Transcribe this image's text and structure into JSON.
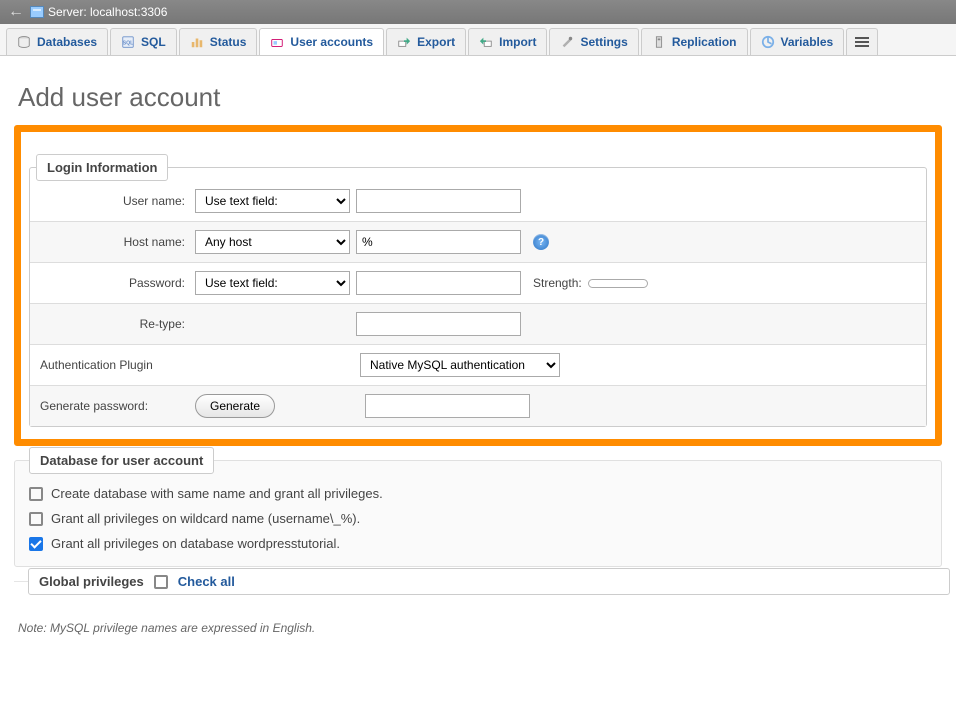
{
  "server_bar": {
    "back_arrow": "←",
    "label": "Server: localhost:3306"
  },
  "tabs": {
    "databases": "Databases",
    "sql": "SQL",
    "status": "Status",
    "user_accounts": "User accounts",
    "export": "Export",
    "import": "Import",
    "settings": "Settings",
    "replication": "Replication",
    "variables": "Variables"
  },
  "page_title": "Add user account",
  "login_info": {
    "legend": "Login Information",
    "rows": {
      "user_name": {
        "label": "User name:",
        "select": "Use text field:",
        "value": ""
      },
      "host_name": {
        "label": "Host name:",
        "select": "Any host",
        "value": "%"
      },
      "password": {
        "label": "Password:",
        "select": "Use text field:",
        "value": "",
        "strength_label": "Strength:"
      },
      "retype": {
        "label": "Re-type:",
        "value": ""
      },
      "auth": {
        "label": "Authentication Plugin",
        "select": "Native MySQL authentication"
      },
      "generate": {
        "label": "Generate password:",
        "button": "Generate",
        "value": ""
      }
    }
  },
  "db_section": {
    "legend": "Database for user account",
    "options": [
      {
        "label": "Create database with same name and grant all privileges.",
        "checked": false
      },
      {
        "label": "Grant all privileges on wildcard name (username\\_%).",
        "checked": false
      },
      {
        "label": "Grant all privileges on database wordpresstutorial.",
        "checked": true
      }
    ]
  },
  "priv_section": {
    "legend": "Global privileges",
    "check_all": "Check all"
  },
  "note": "Note: MySQL privilege names are expressed in English."
}
